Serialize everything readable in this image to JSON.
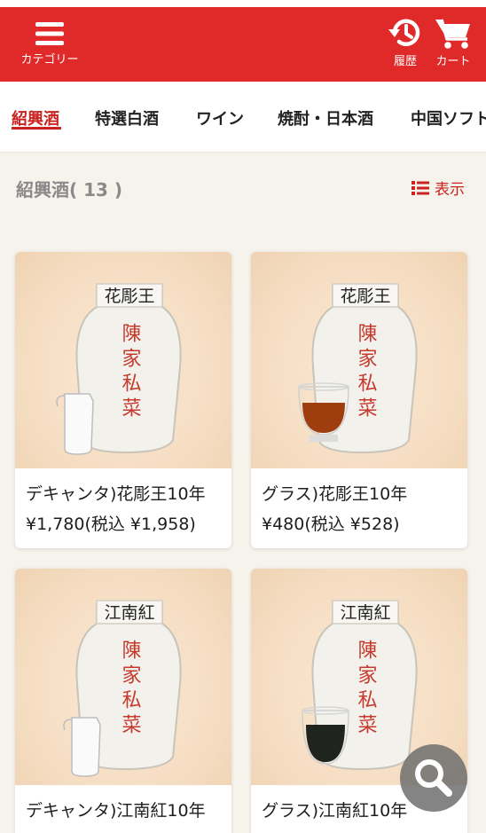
{
  "header": {
    "menu_label": "カテゴリー",
    "history_label": "履歴",
    "cart_label": "カート"
  },
  "tabs": [
    {
      "label": "紹興酒",
      "active": true
    },
    {
      "label": "特選白酒",
      "active": false
    },
    {
      "label": "ワイン",
      "active": false
    },
    {
      "label": "焼酎・日本酒",
      "active": false
    },
    {
      "label": "中国ソフト",
      "active": false
    }
  ],
  "list": {
    "category_count": "紹興酒( 13 )",
    "view_label": "表示"
  },
  "products": [
    {
      "name": "デキャンタ)花彫王10年",
      "price": "¥1,780(税込 ¥1,958)",
      "jar_label": "花彫王",
      "brand": "陳家私菜",
      "vessel": "decanter"
    },
    {
      "name": "グラス)花彫王10年",
      "price": "¥480(税込 ¥528)",
      "jar_label": "花彫王",
      "brand": "陳家私菜",
      "vessel": "glass-amber"
    },
    {
      "name": "デキャンタ)江南紅10年",
      "price": "",
      "jar_label": "江南紅",
      "brand": "陳家私菜",
      "vessel": "decanter"
    },
    {
      "name": "グラス)江南紅10年",
      "price": "",
      "jar_label": "江南紅",
      "brand": "陳家私菜",
      "vessel": "glass-dark"
    }
  ],
  "colors": {
    "brand_red": "#e02a2a",
    "accent_red": "#c8231f",
    "background": "#f6f2ec"
  },
  "icons": [
    "menu-icon",
    "history-icon",
    "cart-icon",
    "list-view-icon",
    "search-icon"
  ]
}
